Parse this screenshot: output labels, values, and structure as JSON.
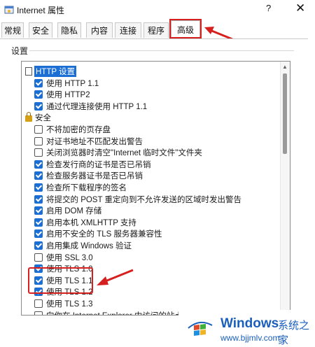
{
  "window": {
    "title": "Internet 属性",
    "help": "?",
    "close": "✕"
  },
  "tabs": [
    "常规",
    "安全",
    "隐私",
    "内容",
    "连接",
    "程序",
    "高级"
  ],
  "selected_tab": "高级",
  "settings": {
    "group_label": "设置",
    "items": [
      {
        "kind": "category",
        "label": "HTTP 设置",
        "icon": "document-icon",
        "selected": true
      },
      {
        "kind": "checkbox",
        "label": "使用 HTTP 1.1",
        "checked": true
      },
      {
        "kind": "checkbox",
        "label": "使用 HTTP2",
        "checked": true
      },
      {
        "kind": "checkbox",
        "label": "通过代理连接使用 HTTP 1.1",
        "checked": true
      },
      {
        "kind": "category",
        "label": "安全",
        "icon": "lock-icon",
        "selected": false
      },
      {
        "kind": "checkbox",
        "label": "不将加密的页存盘",
        "checked": false
      },
      {
        "kind": "checkbox",
        "label": "对证书地址不匹配发出警告",
        "checked": false
      },
      {
        "kind": "checkbox",
        "label": "关闭浏览器时清空\"Internet 临时文件\"文件夹",
        "checked": false
      },
      {
        "kind": "checkbox",
        "label": "检查发行商的证书是否已吊销",
        "checked": true
      },
      {
        "kind": "checkbox",
        "label": "检查服务器证书是否已吊销",
        "checked": true
      },
      {
        "kind": "checkbox",
        "label": "检查所下载程序的签名",
        "checked": true
      },
      {
        "kind": "checkbox",
        "label": "将提交的 POST 重定向到不允许发送的区域时发出警告",
        "checked": true
      },
      {
        "kind": "checkbox",
        "label": "启用 DOM 存储",
        "checked": true
      },
      {
        "kind": "checkbox",
        "label": "启用本机 XMLHTTP 支持",
        "checked": true
      },
      {
        "kind": "checkbox",
        "label": "启用不安全的 TLS 服务器兼容性",
        "checked": true
      },
      {
        "kind": "checkbox",
        "label": "启用集成 Windows 验证",
        "checked": true
      },
      {
        "kind": "checkbox",
        "label": "使用 SSL 3.0",
        "checked": false
      },
      {
        "kind": "checkbox",
        "label": "使用 TLS 1.0",
        "checked": true
      },
      {
        "kind": "checkbox",
        "label": "使用 TLS 1.1",
        "checked": true
      },
      {
        "kind": "checkbox",
        "label": "使用 TLS 1.2",
        "checked": true
      },
      {
        "kind": "checkbox",
        "label": "使用 TLS 1.3",
        "checked": false
      },
      {
        "kind": "checkbox",
        "label": "向你在 Internet Explorer 中访问的站点发送",
        "checked": false
      }
    ]
  },
  "watermark": {
    "brand": "Windows",
    "cn": "系统之家",
    "url": "www.bjjmlv.com"
  },
  "colors": {
    "accent": "#1b6fd4",
    "annotation": "#d62020"
  }
}
